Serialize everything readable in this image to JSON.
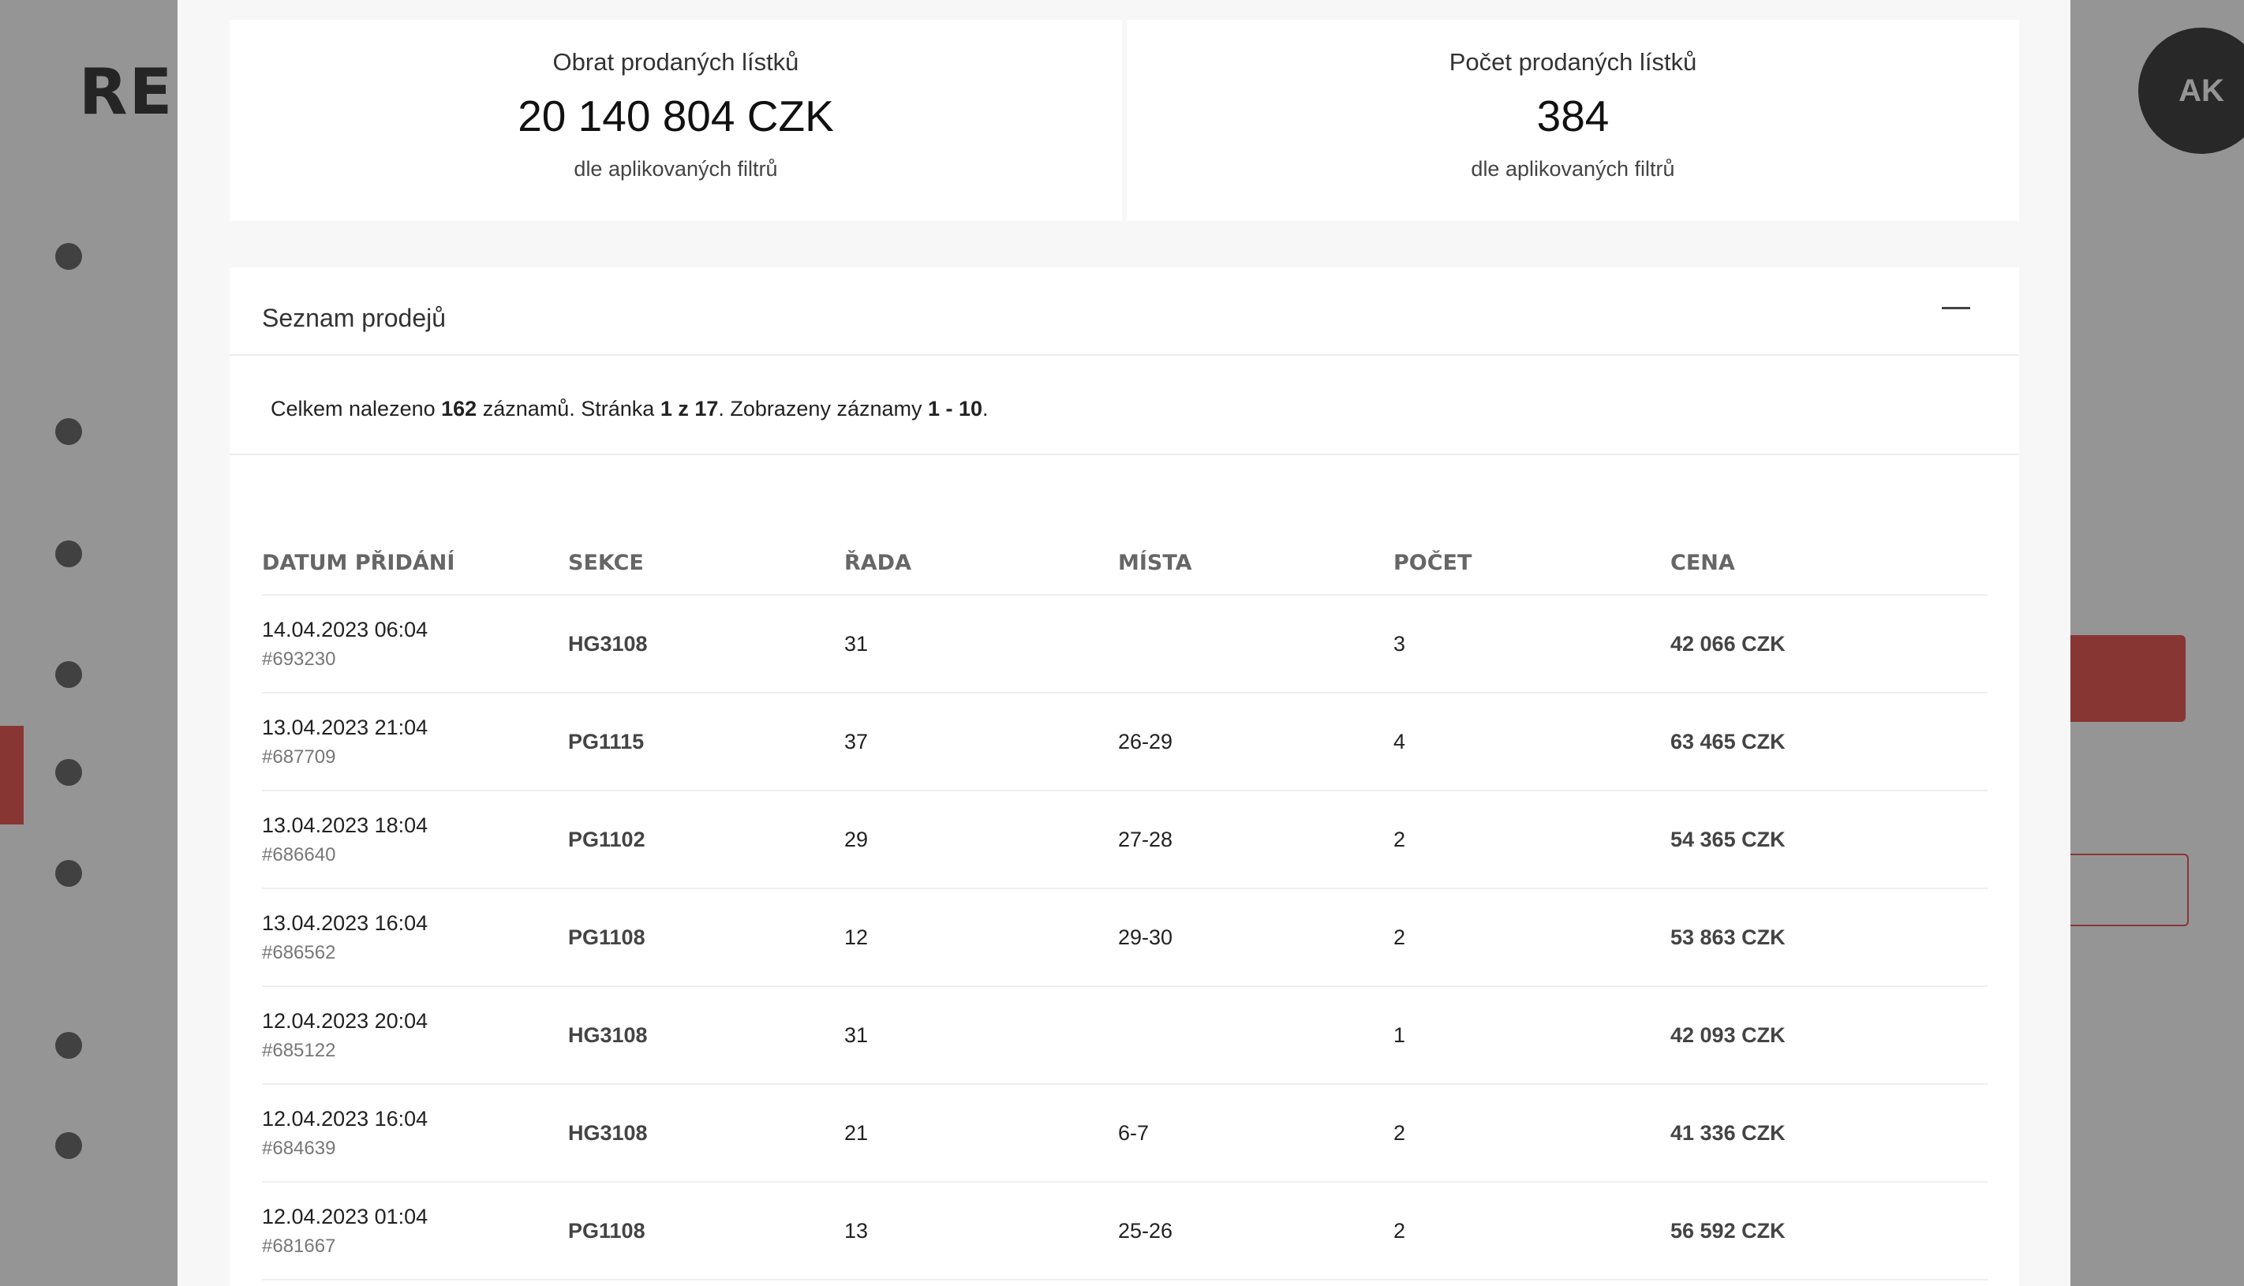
{
  "background": {
    "logo": "RESE",
    "avatar_initials": "AK"
  },
  "stats": [
    {
      "title": "Obrat prodaných lístků",
      "value": "20 140 804 CZK",
      "subtitle": "dle aplikovaných filtrů"
    },
    {
      "title": "Počet prodaných lístků",
      "value": "384",
      "subtitle": "dle aplikovaných filtrů"
    }
  ],
  "panel": {
    "title": "Seznam prodejů",
    "summary": {
      "prefix": "Celkem nalezeno ",
      "total": "162",
      "mid1": " záznamů. Stránka ",
      "page": "1 z 17",
      "mid2": ". Zobrazeny záznamy ",
      "range": "1 - 10",
      "suffix": "."
    }
  },
  "table": {
    "headers": [
      "DATUM PŘIDÁNÍ",
      "SEKCE",
      "ŘADA",
      "MÍSTA",
      "POČET",
      "CENA"
    ],
    "rows": [
      {
        "date": "14.04.2023 06:04",
        "id": "#693230",
        "section": "HG3108",
        "row": "31",
        "seats": "",
        "count": "3",
        "price": "42 066 CZK"
      },
      {
        "date": "13.04.2023 21:04",
        "id": "#687709",
        "section": "PG1115",
        "row": "37",
        "seats": "26-29",
        "count": "4",
        "price": "63 465 CZK"
      },
      {
        "date": "13.04.2023 18:04",
        "id": "#686640",
        "section": "PG1102",
        "row": "29",
        "seats": "27-28",
        "count": "2",
        "price": "54 365 CZK"
      },
      {
        "date": "13.04.2023 16:04",
        "id": "#686562",
        "section": "PG1108",
        "row": "12",
        "seats": "29-30",
        "count": "2",
        "price": "53 863 CZK"
      },
      {
        "date": "12.04.2023 20:04",
        "id": "#685122",
        "section": "HG3108",
        "row": "31",
        "seats": "",
        "count": "1",
        "price": "42 093 CZK"
      },
      {
        "date": "12.04.2023 16:04",
        "id": "#684639",
        "section": "HG3108",
        "row": "21",
        "seats": "6-7",
        "count": "2",
        "price": "41 336 CZK"
      },
      {
        "date": "12.04.2023 01:04",
        "id": "#681667",
        "section": "PG1108",
        "row": "13",
        "seats": "25-26",
        "count": "2",
        "price": "56 592 CZK"
      }
    ]
  }
}
